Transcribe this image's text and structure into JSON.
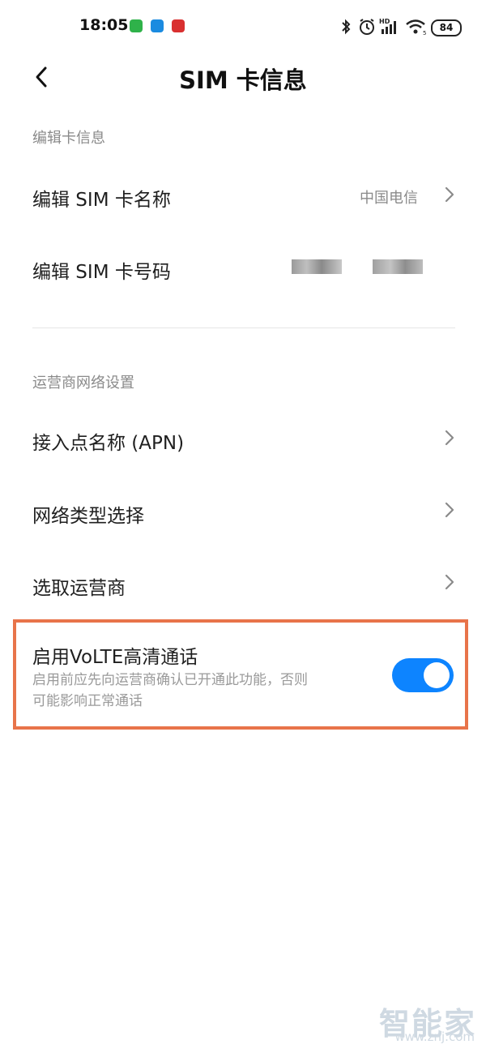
{
  "status_bar": {
    "time": "18:05",
    "battery": "84",
    "icons": [
      "bluetooth-icon",
      "alarm-icon",
      "signal-hd-icon",
      "wifi-icon"
    ]
  },
  "header": {
    "title": "SIM 卡信息",
    "back_icon": "chevron-left-icon"
  },
  "sections": {
    "edit": {
      "label": "编辑卡信息",
      "name_row": {
        "label": "编辑 SIM 卡名称",
        "value": "中国电信"
      },
      "number_row": {
        "label": "编辑 SIM 卡号码"
      }
    },
    "network": {
      "label": "运营商网络设置",
      "apn_row": {
        "label": "接入点名称 (APN)"
      },
      "type_row": {
        "label": "网络类型选择"
      },
      "carrier_row": {
        "label": "选取运营商"
      }
    }
  },
  "volte": {
    "label": "启用VoLTE高清通话",
    "desc_line1": "启用前应先向运营商确认已开通此功能，否则",
    "desc_line2": "可能影响正常通话",
    "enabled": true
  },
  "watermark": {
    "logo": "智能家",
    "url": "www.znj.com"
  },
  "colors": {
    "accent": "#0d84ff",
    "highlight_border": "#e8744a",
    "secondary_text": "#8a8a8a"
  }
}
